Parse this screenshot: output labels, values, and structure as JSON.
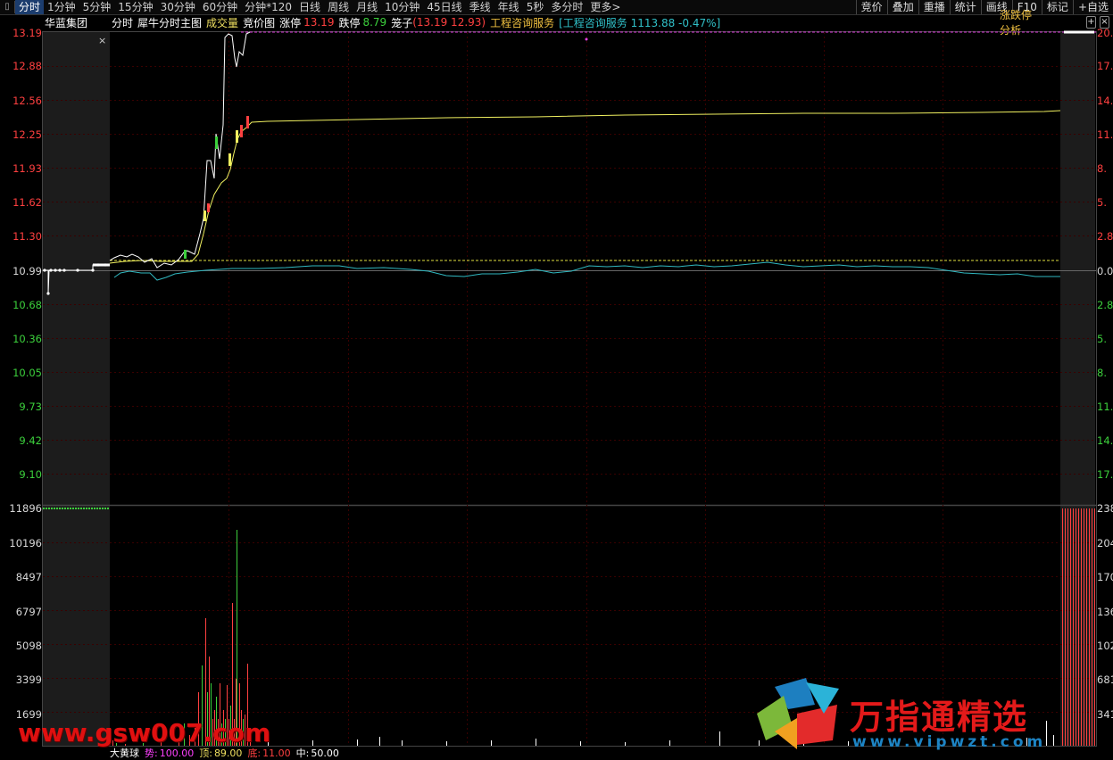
{
  "toolbar": {
    "left_icon": "▯",
    "periods": [
      "分时",
      "1分钟",
      "5分钟",
      "15分钟",
      "30分钟",
      "60分钟",
      "分钟*120",
      "日线",
      "周线",
      "月线",
      "10分钟",
      "45日线",
      "季线",
      "年线",
      "5秒",
      "多分时",
      "更多>"
    ],
    "tools": [
      "竞价",
      "叠加",
      "重播",
      "统计",
      "画线",
      "F10",
      "标记",
      "+自选"
    ]
  },
  "info": {
    "stock_name": "华蓝集团",
    "mode": "分时",
    "indicator": "犀牛分时主图",
    "volume_label": "成交量",
    "auction_label": "竞价图",
    "limit_up_label": "涨停",
    "limit_up_value": "13.19",
    "limit_down_label": "跌停",
    "limit_down_value": "8.79",
    "cage_label": "笼子",
    "cage_value": "(13.19 12.93)",
    "sector": "工程咨询服务",
    "sector_index": "[工程咨询服务 1113.88 -0.47%]",
    "analysis_button": "涨跌停分析",
    "close_glyph": "×"
  },
  "colors": {
    "up": "#ff4040",
    "down": "#3cd03c",
    "neutral": "#d8d8d8",
    "avg_line": "#f0f060",
    "sector_line": "#30b8c0",
    "price_line": "#ffffff",
    "accent_magenta": "#e040e0",
    "grid": "#3a0000",
    "brand_red": "#e31a1a",
    "brand_blue": "#1d84c4"
  },
  "price_axis": {
    "up": [
      "13.19",
      "12.88",
      "12.56",
      "12.25",
      "11.93",
      "11.62",
      "11.30"
    ],
    "mid": "10.99",
    "down": [
      "10.68",
      "10.36",
      "10.05",
      "9.73",
      "9.42",
      "9.10"
    ]
  },
  "pct_axis": {
    "up": [
      "20.",
      "17.",
      "14.",
      "11.",
      "8.",
      "5.",
      "2.8"
    ],
    "mid": "0.0",
    "down": [
      "2.8",
      "5.",
      "8.",
      "11.",
      "14.",
      "17."
    ]
  },
  "volume_axis": [
    "11896",
    "10196",
    "8497",
    "6797",
    "5098",
    "3399",
    "1699"
  ],
  "volume_axis_right": [
    "238",
    "204",
    "170",
    "136",
    "102",
    "681",
    "341"
  ],
  "indicator_bar": {
    "name": "大黄球",
    "trend_label": "势:",
    "trend_value": "100.00",
    "top_label": "顶:",
    "top_value": "89.00",
    "bottom_label": "底:",
    "bottom_value": "11.00",
    "mid_label": "中:",
    "mid_value": "50.00"
  },
  "watermarks": {
    "left": "www.gsw007.com",
    "brand": "万指通精选",
    "brand_url": "www.vipwzt.com"
  }
}
